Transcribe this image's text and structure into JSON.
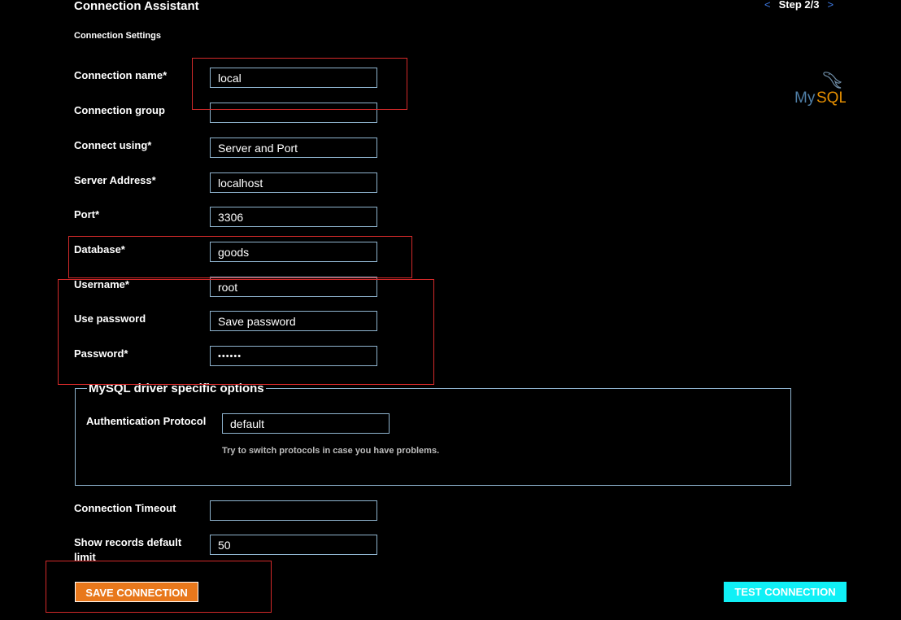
{
  "header": {
    "title": "Connection Assistant",
    "step": "Step 2/3",
    "prev_icon": "<",
    "next_icon": ">"
  },
  "section": {
    "label": "Connection Settings"
  },
  "logo": {
    "text_my": "My",
    "text_sql": "SQL",
    "icon": "mysql-dolphin-logo"
  },
  "form": {
    "connection_name": {
      "label": "Connection name*",
      "value": "local"
    },
    "connection_group": {
      "label": "Connection group",
      "value": ""
    },
    "connect_using": {
      "label": "Connect using*",
      "value": "Server and Port"
    },
    "server_address": {
      "label": "Server Address*",
      "value": "localhost"
    },
    "port": {
      "label": "Port*",
      "value": "3306"
    },
    "database": {
      "label": "Database*",
      "value": "goods"
    },
    "username": {
      "label": "Username*",
      "value": "root"
    },
    "use_password": {
      "label": "Use password",
      "value": "Save password"
    },
    "password": {
      "label": "Password*",
      "value": "••••••"
    }
  },
  "driver_options": {
    "legend": "MySQL driver specific options",
    "auth_protocol": {
      "label": "Authentication Protocol",
      "value": "default"
    },
    "hint": "Try to switch protocols in case you have problems."
  },
  "extra": {
    "connection_timeout": {
      "label": "Connection Timeout",
      "value": ""
    },
    "records_limit": {
      "label": "Show records default limit",
      "value": "50"
    }
  },
  "buttons": {
    "save": "SAVE CONNECTION",
    "test": "TEST CONNECTION"
  },
  "colors": {
    "accent_orange": "#e8781c",
    "accent_cyan": "#10f0f6",
    "field_border": "#8fb4cf",
    "annotation_red": "#d42a2a",
    "nav_arrow": "#3e7be6"
  }
}
